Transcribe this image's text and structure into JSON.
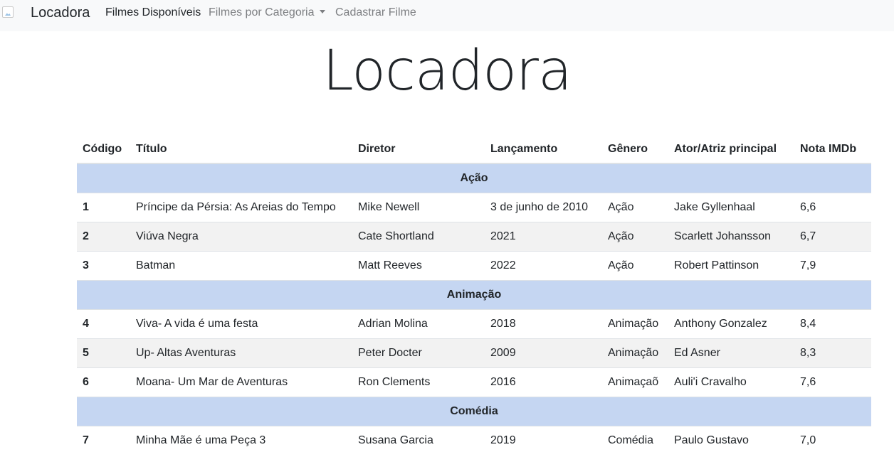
{
  "navbar": {
    "brand": "Locadora",
    "links": [
      {
        "label": "Filmes Disponíveis"
      },
      {
        "label": "Filmes por Categoria"
      },
      {
        "label": "Cadastrar Filme"
      }
    ]
  },
  "page_title": "Locadora",
  "table": {
    "headers": [
      "Código",
      "Título",
      "Diretor",
      "Lançamento",
      "Gênero",
      "Ator/Atriz principal",
      "Nota IMDb"
    ],
    "groups": [
      "Ação",
      "Animação",
      "Comédia"
    ],
    "rows": [
      [
        "1",
        "Príncipe da Pérsia: As Areias do Tempo",
        "Mike Newell",
        "3 de junho de 2010",
        "Ação",
        "Jake Gyllenhaal",
        "6,6"
      ],
      [
        "2",
        "Viúva Negra",
        "Cate Shortland",
        "2021",
        "Ação",
        "Scarlett Johansson",
        "6,7"
      ],
      [
        "3",
        "Batman",
        "Matt Reeves",
        "2022",
        "Ação",
        "Robert Pattinson",
        "7,9"
      ],
      [
        "4",
        "Viva- A vida é uma festa",
        "Adrian Molina",
        "2018",
        "Animação",
        "Anthony Gonzalez",
        "8,4"
      ],
      [
        "5",
        "Up- Altas Aventuras",
        "Peter Docter",
        "2009",
        "Animação",
        "Ed Asner",
        "8,3"
      ],
      [
        "6",
        "Moana- Um Mar de Aventuras",
        "Ron Clements",
        "2016",
        "Animaçaõ",
        "Auli'i Cravalho",
        "7,6"
      ],
      [
        "7",
        "Minha Mãe é uma Peça 3",
        "Susana Garcia",
        "2019",
        "Comédia",
        "Paulo Gustavo",
        "7,0"
      ]
    ]
  }
}
